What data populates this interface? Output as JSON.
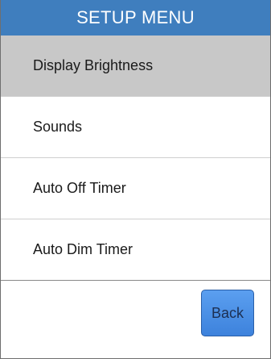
{
  "header": {
    "title": "SETUP MENU"
  },
  "menu": {
    "items": [
      {
        "label": "Display Brightness",
        "selected": true
      },
      {
        "label": "Sounds",
        "selected": false
      },
      {
        "label": "Auto Off Timer",
        "selected": false
      },
      {
        "label": "Auto Dim Timer",
        "selected": false
      }
    ]
  },
  "footer": {
    "back_label": "Back"
  },
  "colors": {
    "header_bg": "#3f7ebe",
    "selected_bg": "#c8c8c8",
    "button_bg": "#4a90e6"
  }
}
